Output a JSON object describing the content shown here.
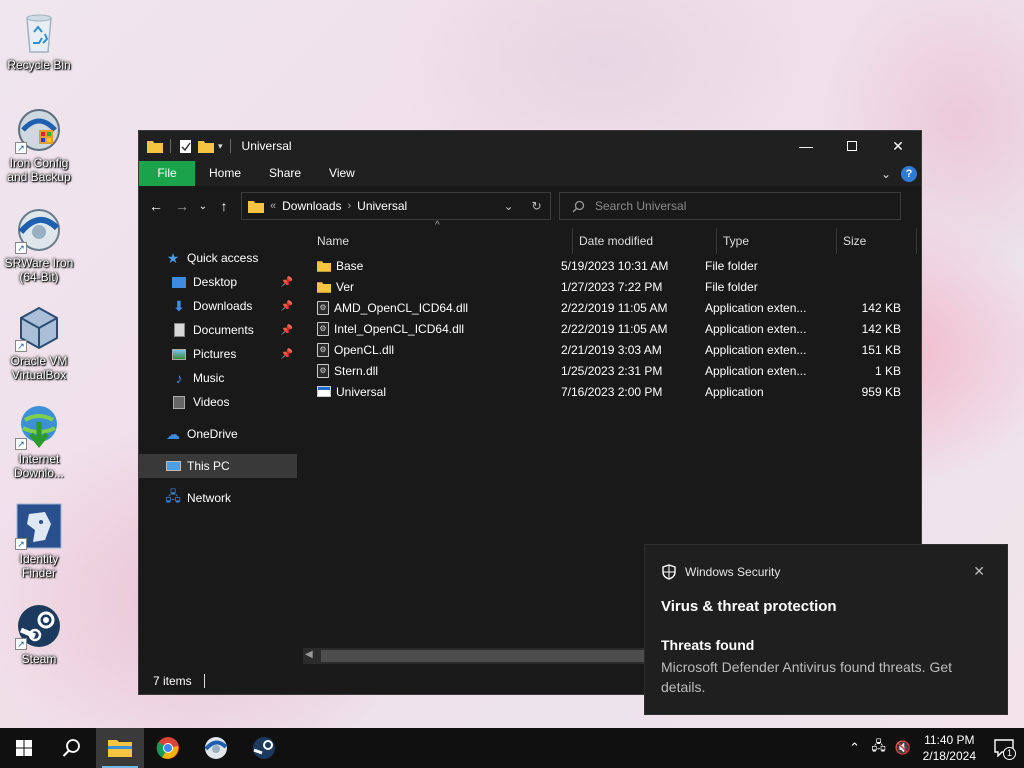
{
  "desktop": {
    "icons": [
      {
        "label": "Recycle Bin"
      },
      {
        "label": "Iron Config and Backup"
      },
      {
        "label": "SRWare Iron (64-Bit)"
      },
      {
        "label": "Oracle VM VirtualBox"
      },
      {
        "label": "Internet Downlo..."
      },
      {
        "label": "Identity Finder"
      },
      {
        "label": "Steam"
      }
    ]
  },
  "window": {
    "title": "Universal",
    "ribbon": {
      "file": "File",
      "home": "Home",
      "share": "Share",
      "view": "View"
    },
    "address": {
      "crumb_prefix": "«",
      "crumb1": "Downloads",
      "crumb2": "Universal"
    },
    "search": {
      "placeholder": "Search Universal"
    },
    "nav": {
      "quick_access": "Quick access",
      "items": [
        "Desktop",
        "Downloads",
        "Documents",
        "Pictures",
        "Music",
        "Videos"
      ],
      "onedrive": "OneDrive",
      "this_pc": "This PC",
      "network": "Network"
    },
    "columns": {
      "name": "Name",
      "date": "Date modified",
      "type": "Type",
      "size": "Size"
    },
    "files": [
      {
        "name": "Base",
        "date": "5/19/2023 10:31 AM",
        "type": "File folder",
        "size": "",
        "kind": "folder"
      },
      {
        "name": "Ver",
        "date": "1/27/2023 7:22 PM",
        "type": "File folder",
        "size": "",
        "kind": "folder"
      },
      {
        "name": "AMD_OpenCL_ICD64.dll",
        "date": "2/22/2019 11:05 AM",
        "type": "Application exten...",
        "size": "142 KB",
        "kind": "dll"
      },
      {
        "name": "Intel_OpenCL_ICD64.dll",
        "date": "2/22/2019 11:05 AM",
        "type": "Application exten...",
        "size": "142 KB",
        "kind": "dll"
      },
      {
        "name": "OpenCL.dll",
        "date": "2/21/2019 3:03 AM",
        "type": "Application exten...",
        "size": "151 KB",
        "kind": "dll"
      },
      {
        "name": "Stern.dll",
        "date": "1/25/2023 2:31 PM",
        "type": "Application exten...",
        "size": "1 KB",
        "kind": "dll"
      },
      {
        "name": "Universal",
        "date": "7/16/2023 2:00 PM",
        "type": "Application",
        "size": "959 KB",
        "kind": "app"
      }
    ],
    "status": "7 items"
  },
  "toast": {
    "app": "Windows Security",
    "title": "Virus & threat protection",
    "heading": "Threats found",
    "body": "Microsoft Defender Antivirus found threats. Get details."
  },
  "taskbar": {
    "time": "11:40 PM",
    "date": "2/18/2024",
    "notification_count": "1"
  },
  "colors": {
    "file_tab": "#1aa34a",
    "folder": "#f5c542",
    "accent": "#76b9ed"
  }
}
